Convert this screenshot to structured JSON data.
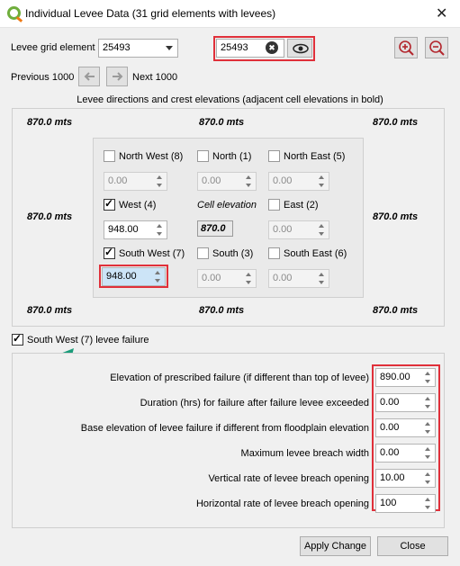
{
  "window": {
    "title": "Individual Levee Data (31 grid elements with levees)",
    "close": "✕"
  },
  "toolbar": {
    "grid_label": "Levee grid element",
    "grid_value": "25493",
    "search_value": "25493",
    "prev_label": "Previous 1000",
    "next_label": "Next 1000",
    "clear_icon": "✖",
    "eye_icon": "👁",
    "zoom_in_icon": "⊕",
    "zoom_out_icon": "⊖"
  },
  "section_title": "Levee directions and crest elevations (adjacent cell elevations in bold)",
  "elevations": {
    "top_left": "870.0  mts",
    "top_center": "870.0  mts",
    "top_right": "870.0  mts",
    "mid_left": "870.0  mts",
    "mid_right": "870.0  mts",
    "bot_left": "870.0  mts",
    "bot_center": "870.0  mts",
    "bot_right": "870.0  mts"
  },
  "directions": {
    "nw": {
      "label": "North West (8)",
      "value": "0.00",
      "checked": false
    },
    "n": {
      "label": "North (1)",
      "value": "0.00",
      "checked": false
    },
    "ne": {
      "label": "North East (5)",
      "value": "0.00",
      "checked": false
    },
    "w": {
      "label": "West (4)",
      "value": "948.00",
      "checked": true
    },
    "e": {
      "label": "East (2)",
      "value": "0.00",
      "checked": false
    },
    "sw": {
      "label": "South West (7)",
      "value": "948.00",
      "checked": true
    },
    "s": {
      "label": "South (3)",
      "value": "0.00",
      "checked": false
    },
    "se": {
      "label": "South East (6)",
      "value": "0.00",
      "checked": false
    },
    "cell_label": "Cell elevation",
    "cell_value": "870.0"
  },
  "failure": {
    "checkbox_label": "South West (7)  levee failure",
    "checked": true,
    "rows": [
      {
        "label": "Elevation of prescribed failure (if different than top of levee)",
        "value": "890.00"
      },
      {
        "label": "Duration (hrs) for failure after failure levee exceeded",
        "value": "0.00"
      },
      {
        "label": "Base elevation of levee failure if different from floodplain elevation",
        "value": "0.00"
      },
      {
        "label": "Maximum levee breach width",
        "value": "0.00"
      },
      {
        "label": "Vertical rate of levee breach opening",
        "value": "10.00"
      },
      {
        "label": "Horizontal rate of levee breach opening",
        "value": "100"
      }
    ]
  },
  "buttons": {
    "apply": "Apply Change",
    "close": "Close"
  },
  "colors": {
    "highlight": "#e0303a",
    "arrow": "#1a9c7a",
    "selection": "#cce4f7"
  }
}
